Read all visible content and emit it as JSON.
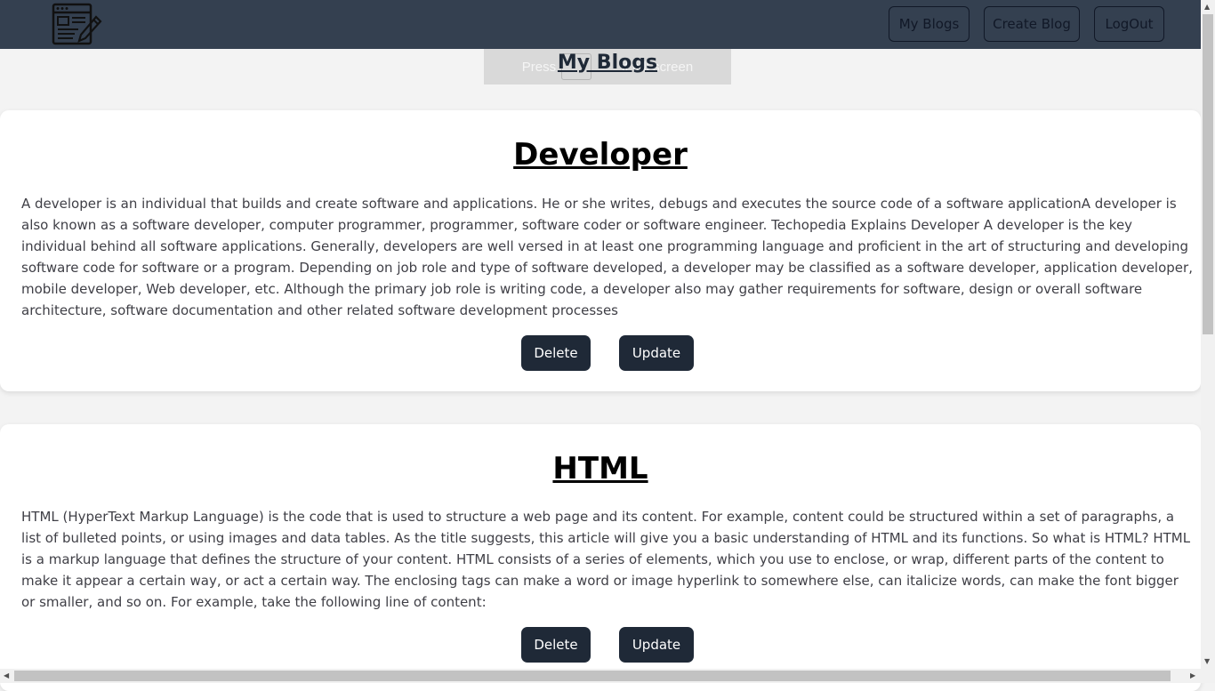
{
  "nav": {
    "logo_icon": "blog-editor-icon",
    "links": [
      "My Blogs",
      "Create Blog",
      "LogOut"
    ]
  },
  "fullscreen_notice": {
    "press": "Press",
    "rest": "it full screen"
  },
  "page_title": "My Blogs",
  "blogs": [
    {
      "title": "Developer",
      "body": "A developer is an individual that builds and create software and applications. He or she writes, debugs and executes the source code of a software applicationA developer is also known as a software developer, computer programmer, programmer, software coder or software engineer. Techopedia Explains Developer A developer is the key individual behind all software applications. Generally, developers are well versed in at least one programming language and proficient in the art of structuring and developing software code for software or a program. Depending on job role and type of software developed, a developer may be classified as a software developer, application developer, mobile developer, Web developer, etc. Although the primary job role is writing code, a developer also may gather requirements for software, design or overall software architecture, software documentation and other related software development processes",
      "delete_label": "Delete",
      "update_label": "Update"
    },
    {
      "title": "HTML",
      "body": "HTML (HyperText Markup Language) is the code that is used to structure a web page and its content. For example, content could be structured within a set of paragraphs, a list of bulleted points, or using images and data tables. As the title suggests, this article will give you a basic understanding of HTML and its functions. So what is HTML? HTML is a markup language that defines the structure of your content. HTML consists of a series of elements, which you use to enclose, or wrap, different parts of the content to make it appear a certain way, or act a certain way. The enclosing tags can make a word or image hyperlink to somewhere else, can italicize words, can make the font bigger or smaller, and so on. For example, take the following line of content:",
      "delete_label": "Delete",
      "update_label": "Update"
    }
  ],
  "colors": {
    "navbar": "#344050",
    "button_dark": "#1f2937",
    "page_bg": "#f3f3f3"
  }
}
